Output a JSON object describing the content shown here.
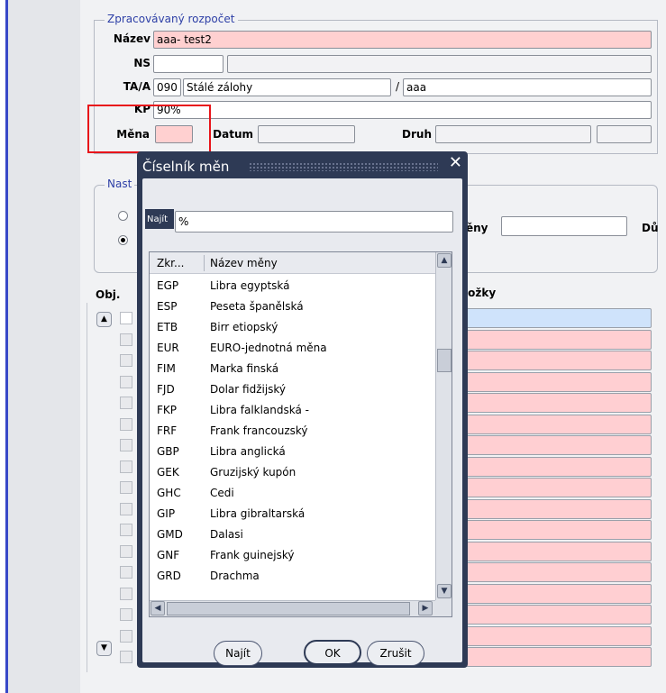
{
  "form": {
    "group_title": "Zpracovávaný rozpočet",
    "nazev_label": "Název",
    "nazev_value": "aaa- test2",
    "ns_label": "NS",
    "ta_label": "TA/A",
    "ta_code": "090",
    "ta_name": "Stálé zálohy",
    "ta_slash": "/",
    "ta_sub": "aaa",
    "kp_label": "KP",
    "kp_value": "90%",
    "mena_label": "Měna",
    "datum_label": "Datum",
    "druh_label": "Druh"
  },
  "group2": {
    "title": "Nast",
    "meny_label": "ěny",
    "du_label": "Dů"
  },
  "table": {
    "obj_label": "Obj.",
    "polozky_label": "ložky",
    "row_count": 17
  },
  "dialog": {
    "title": "Číselník měn",
    "close": "✕",
    "find_label": "Najít",
    "find_value": "%",
    "columns": [
      "Zkr...",
      "Název měny"
    ],
    "rows": [
      {
        "code": "EGP",
        "name": "Libra egyptská"
      },
      {
        "code": "ESP",
        "name": "Peseta španělská"
      },
      {
        "code": "ETB",
        "name": "Birr etiopský"
      },
      {
        "code": "EUR",
        "name": "EURO-jednotná měna"
      },
      {
        "code": "FIM",
        "name": "Marka finská"
      },
      {
        "code": "FJD",
        "name": "Dolar fidžijský"
      },
      {
        "code": "FKP",
        "name": "Libra falklandská -"
      },
      {
        "code": "FRF",
        "name": "Frank francouzský"
      },
      {
        "code": "GBP",
        "name": "Libra anglická"
      },
      {
        "code": "GEK",
        "name": "Gruzijský kupón"
      },
      {
        "code": "GHC",
        "name": "Cedi"
      },
      {
        "code": "GIP",
        "name": "Libra gibraltarská"
      },
      {
        "code": "GMD",
        "name": "Dalasi"
      },
      {
        "code": "GNF",
        "name": "Frank guinejský"
      },
      {
        "code": "GRD",
        "name": "Drachma"
      }
    ],
    "buttons": {
      "find": "Najít",
      "ok": "OK",
      "cancel": "Zrušit"
    }
  },
  "colors": {
    "required_field": "#ffd0d0",
    "dialog_frame": "#2e3a55",
    "highlight_border": "#e8141a",
    "selected_row": "#cfe3fb"
  }
}
